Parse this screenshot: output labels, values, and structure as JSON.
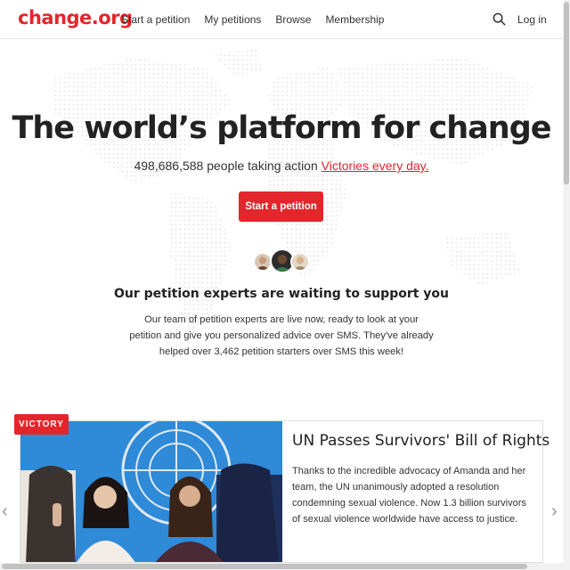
{
  "header": {
    "logo": "change.org",
    "nav": [
      "Start a petition",
      "My petitions",
      "Browse",
      "Membership"
    ],
    "login": "Log in"
  },
  "hero": {
    "title": "The world’s platform for change",
    "count": "498,686,588 people taking action",
    "victories_link": "Victories every day.",
    "cta": "Start a petition"
  },
  "experts": {
    "title": "Our petition experts are waiting to support you",
    "body": "Our team of petition experts are live now, ready to look at your petition and give you personalized advice over SMS. They've already helped over 3,462 petition starters over SMS this week!"
  },
  "victory": {
    "badge": "VICTORY",
    "title": "UN Passes Survivors' Bill of Rights",
    "body": "Thanks to the incredible advocacy of Amanda and her team, the UN unanimously adopted a resolution condemning sexual violence. Now 1.3 billion survivors of sexual violence worldwide have access to justice."
  },
  "colors": {
    "brand": "#e3262b",
    "un_blue": "#2f8ad8"
  },
  "icons": [
    "search-icon",
    "chevron-left-icon",
    "chevron-right-icon"
  ]
}
